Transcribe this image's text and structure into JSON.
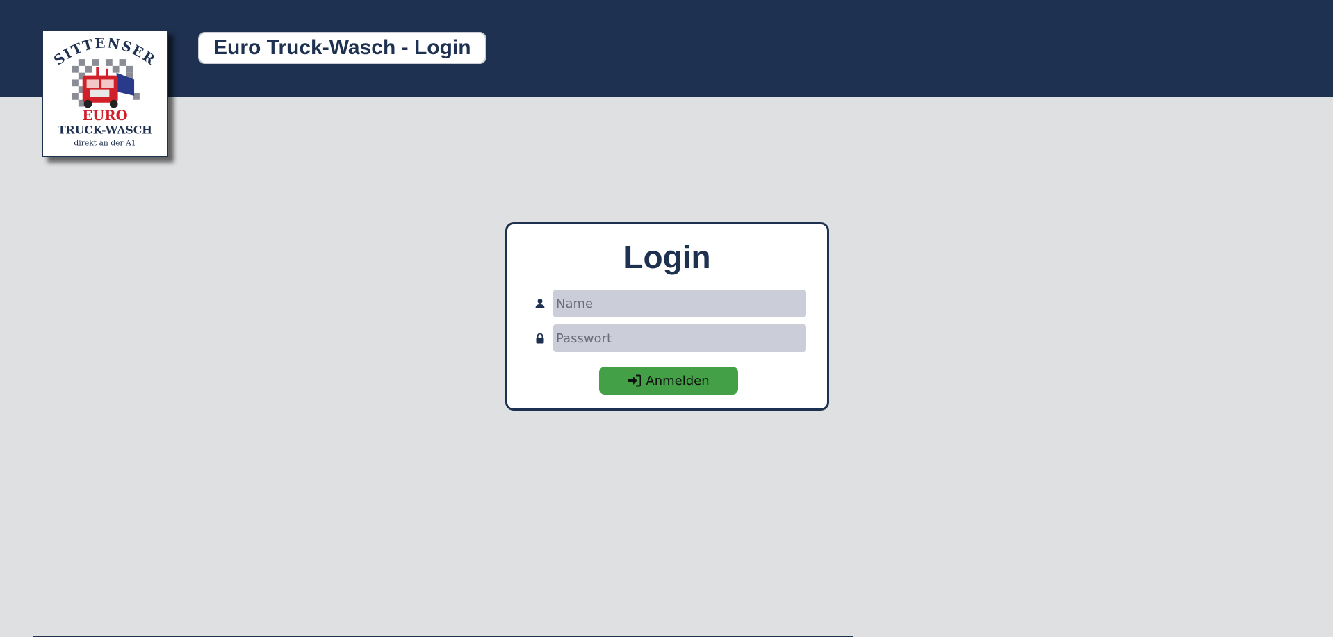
{
  "header": {
    "title": "Euro Truck-Wasch - Login",
    "logo": {
      "top_text": "SITTENSER",
      "brand_text": "EURO",
      "sub_text": "TRUCK-WASCH",
      "tagline": "direkt an der A1"
    }
  },
  "login": {
    "title": "Login",
    "name_placeholder": "Name",
    "password_placeholder": "Passwort",
    "submit_label": "Anmelden"
  },
  "colors": {
    "header_bg": "#1f3150",
    "page_bg": "#dfe0e2",
    "input_bg": "#cbcdd8",
    "button_bg": "#43a047",
    "brand_red": "#d0202a"
  },
  "icons": {
    "name_field": "user-icon",
    "password_field": "lock-icon",
    "submit": "sign-in-icon"
  }
}
